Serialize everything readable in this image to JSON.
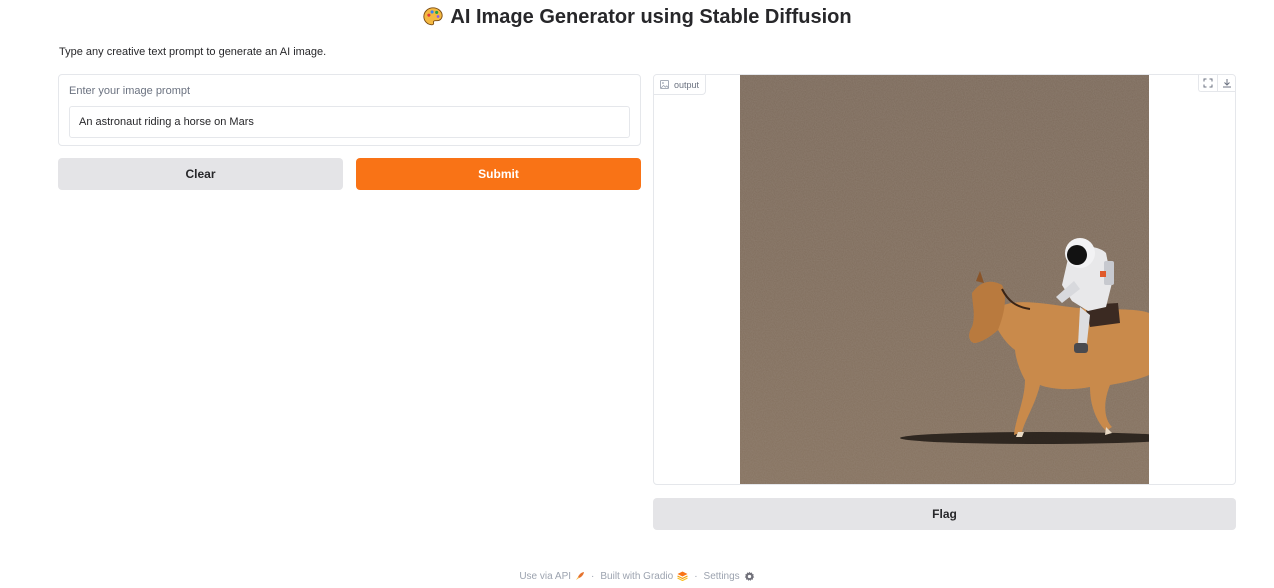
{
  "header": {
    "title": "AI Image Generator using Stable Diffusion",
    "icon": "artist-palette-icon"
  },
  "description": "Type any creative text prompt to generate an AI image.",
  "input": {
    "label": "Enter your image prompt",
    "value": "An astronaut riding a horse on Mars"
  },
  "buttons": {
    "clear": "Clear",
    "submit": "Submit",
    "flag": "Flag"
  },
  "output": {
    "label": "output",
    "label_icon": "image-icon",
    "tools": [
      "fullscreen-icon",
      "download-icon"
    ],
    "image_alt": "Generated image of an astronaut riding a horse on a Mars desert surface"
  },
  "footer": {
    "api": "Use via API",
    "built": "Built with Gradio",
    "settings": "Settings",
    "separator": "·"
  },
  "colors": {
    "accent": "#f97316",
    "secondary_button": "#e4e4e7",
    "border": "#e5e7eb",
    "mars_ground": "#7d6b5a"
  }
}
